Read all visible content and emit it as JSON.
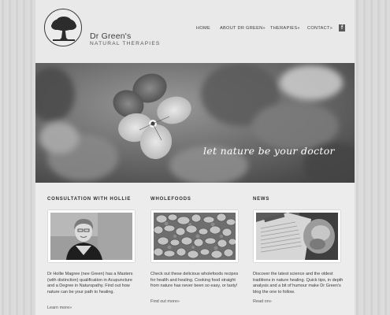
{
  "brand": {
    "name": "Dr Green's",
    "subtitle": "NATURAL THERAPIES"
  },
  "nav": {
    "home": "HOME",
    "about": "ABOUT DR GREEN»",
    "therapies": "THERAPIES»",
    "contact": "CONTACT»",
    "facebook_icon": "facebook-icon"
  },
  "hero": {
    "tagline": "let nature be your doctor"
  },
  "columns": [
    {
      "title": "CONSULTATION WITH HOLLIE",
      "text": "Dr Hollie Magree (nee Green) has a Masters (with distinction) qualification in Acupuncture and a Degree in Naturopathy. Find out how nature can be your path to healing.",
      "link": "Learn more»"
    },
    {
      "title": "WHOLEFOODS",
      "text": "Check out these delicious wholefoods recipes for health and healing. Cooking food straight from nature has never been so easy, or tasty!",
      "link": "Find out more»"
    },
    {
      "title": "NEWS",
      "text": "Discover the latest science and the oldest traditions in nature healing. Quick tips, in depth analysis and a bit of humour make Dr Green's blog the one to follow.",
      "link": "Read on»"
    }
  ]
}
